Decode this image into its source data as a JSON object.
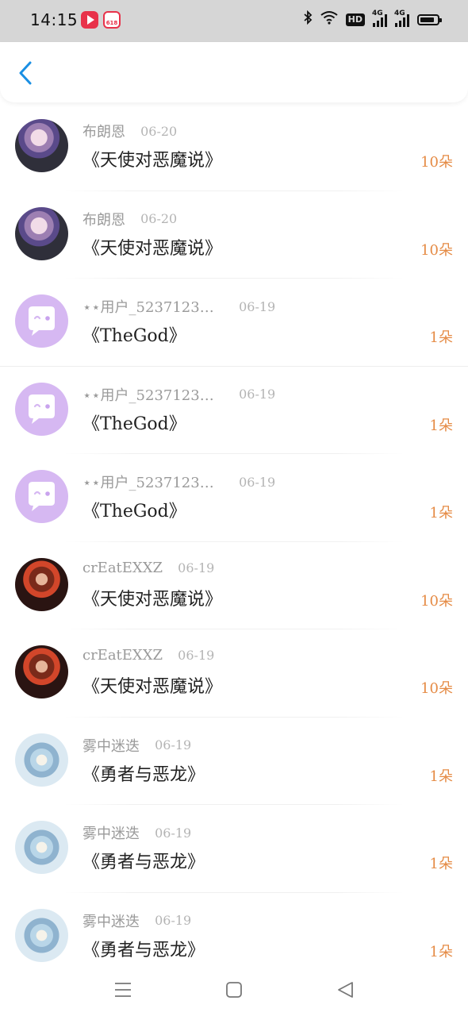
{
  "status_bar": {
    "time": "14:15",
    "app_badges": [
      "video-app-icon",
      "shop-618-icon"
    ],
    "shop_badge_text": "618",
    "hd_label": "HD",
    "network_label_1": "4G",
    "network_label_2": "4G"
  },
  "header": {
    "back_icon": "chevron-left-icon",
    "accent_color": "#1a8fe3"
  },
  "gift_records": [
    {
      "user": "布朗恩",
      "date": "06-20",
      "book": "《天使对恶魔说》",
      "count": "10朵",
      "avatar": "anime-cat-ear-girl"
    },
    {
      "user": "布朗恩",
      "date": "06-20",
      "book": "《天使对恶魔说》",
      "count": "10朵",
      "avatar": "anime-cat-ear-girl"
    },
    {
      "user": "⋆⋆用户_5237123…",
      "date": "06-19",
      "book": "《TheGod》",
      "count": "1朵",
      "avatar": "default-chat-bubble"
    },
    {
      "user": "⋆⋆用户_5237123…",
      "date": "06-19",
      "book": "《TheGod》",
      "count": "1朵",
      "avatar": "default-chat-bubble"
    },
    {
      "user": "⋆⋆用户_5237123…",
      "date": "06-19",
      "book": "《TheGod》",
      "count": "1朵",
      "avatar": "default-chat-bubble"
    },
    {
      "user": "crEatEXXZ",
      "date": "06-19",
      "book": "《天使对恶魔说》",
      "count": "10朵",
      "avatar": "anime-red-dark"
    },
    {
      "user": "crEatEXXZ",
      "date": "06-19",
      "book": "《天使对恶魔说》",
      "count": "10朵",
      "avatar": "anime-red-dark"
    },
    {
      "user": "雾中迷迭",
      "date": "06-19",
      "book": "《勇者与恶龙》",
      "count": "1朵",
      "avatar": "anime-light-blue"
    },
    {
      "user": "雾中迷迭",
      "date": "06-19",
      "book": "《勇者与恶龙》",
      "count": "1朵",
      "avatar": "anime-light-blue"
    },
    {
      "user": "雾中迷迭",
      "date": "06-19",
      "book": "《勇者与恶龙》",
      "count": "1朵",
      "avatar": "anime-light-blue"
    }
  ],
  "colors": {
    "count_color": "#e58b45",
    "username_color": "#9a9a9a",
    "title_color": "#222222",
    "default_avatar_bg": "#d6b8f2"
  },
  "bottom_nav": {
    "icons": [
      "menu-icon",
      "home-square-icon",
      "back-triangle-icon"
    ]
  }
}
